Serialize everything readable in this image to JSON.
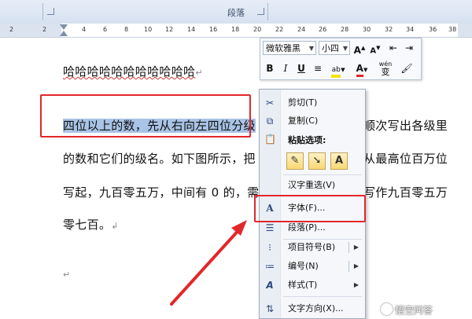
{
  "ribbon": {
    "group_title": "段落"
  },
  "ruler": {
    "numbers": [
      "2",
      "2",
      "4",
      "6",
      "8",
      "10",
      "12",
      "14",
      "16",
      "18",
      "20",
      "22",
      "24",
      "26",
      "28",
      "30",
      "32",
      "34",
      "36",
      "38"
    ]
  },
  "document": {
    "line1": "哈哈哈哈哈哈哈哈哈哈哈",
    "line2_selected": "四位以上的数，先从右向左四位分级",
    "line2_rest": "顺次写出各级里",
    "line3_left": "的数和它们的级名。如下图所示，把",
    "line3_right": "从最高位百万位",
    "line4_left": "写起，九百零五万，中间有 0 的，需",
    "line4_right": "写作九百零五万",
    "line5": "零七百。",
    "paragraph_mark": "↵",
    "paragraph_mark_alt": "↲"
  },
  "mini_toolbar": {
    "font_name": "微软雅黑",
    "font_size": "小四",
    "grow_font": "A",
    "shrink_font": "A",
    "bold": "B",
    "italic": "I",
    "underline": "U",
    "font_color": "A",
    "phonetic": "wén",
    "highlight_color": "#f2e600",
    "font_color_value": "#e3262a"
  },
  "context_menu": {
    "cut": "剪切(T)",
    "copy": "复制(C)",
    "paste_options": "粘贴选项:",
    "paste_text_only": "A",
    "reconvert": "汉字重选(V)",
    "font": "字体(F)...",
    "paragraph": "段落(P)...",
    "bullets": "项目符号(B)",
    "numbering": "编号(N)",
    "styles": "样式(T)",
    "text_direction": "文字方向(X)..."
  },
  "highlight_color": "#e3262a",
  "watermark": {
    "text": "悟空问答"
  }
}
